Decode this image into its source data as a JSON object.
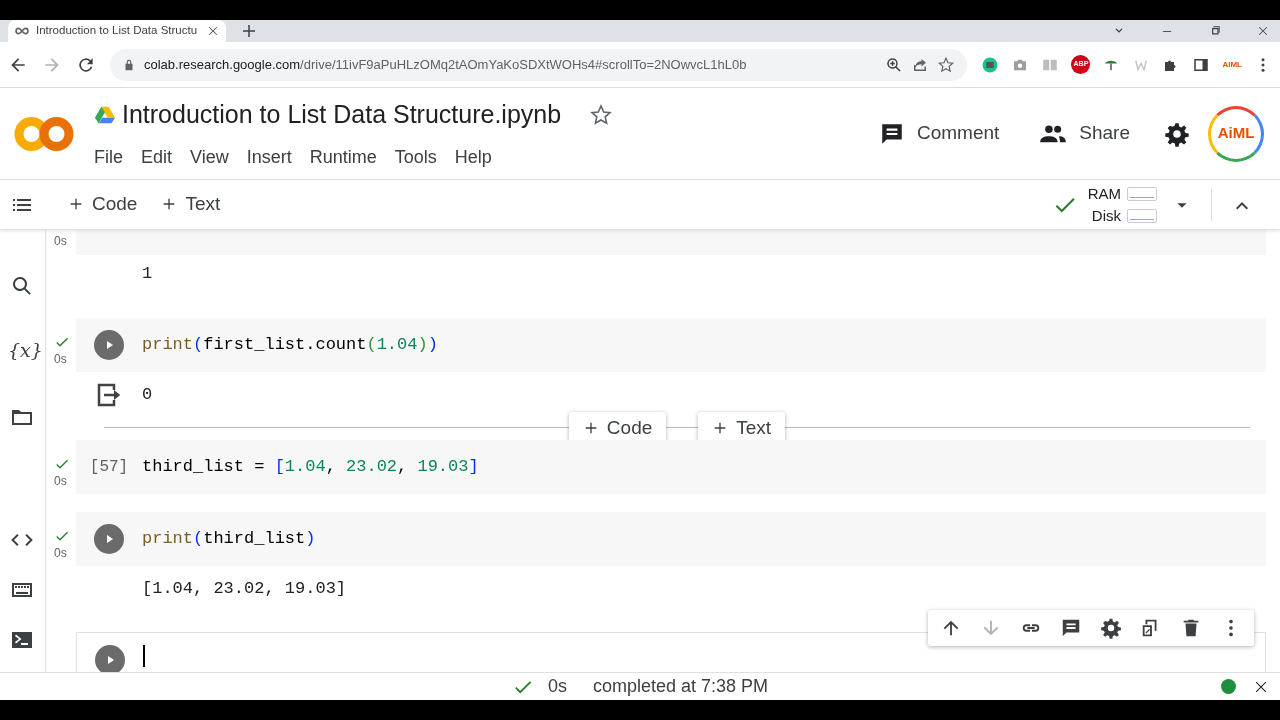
{
  "browser": {
    "tab_title": "Introduction to List Data Structu",
    "url_host": "colab.research.google.com",
    "url_path": "/drive/11ivF9aPuHLzOMq2tAOmYaKoSDXtWOHs4#scrollTo=2NOwvcL1hL0b",
    "extension_labels": [
      "ABP",
      "AIML"
    ]
  },
  "header": {
    "title": "Introduction to List Data Structure.ipynb",
    "starred": false,
    "menu": [
      "File",
      "Edit",
      "View",
      "Insert",
      "Runtime",
      "Tools",
      "Help"
    ],
    "comment": "Comment",
    "share": "Share",
    "avatar_text": "AiML"
  },
  "toolbar": {
    "add_code": "Code",
    "add_text": "Text",
    "ram": "RAM",
    "disk": "Disk",
    "connected": true
  },
  "sidebar": {
    "variables_label": "{x}"
  },
  "cells": [
    {
      "kind": "code",
      "partial": true,
      "exec_time": "0s",
      "output": "1"
    },
    {
      "kind": "code",
      "exec_time": "0s",
      "success": true,
      "code": [
        {
          "kind": "fn",
          "text": "print"
        },
        {
          "kind": "paren",
          "text": "("
        },
        {
          "kind": "name",
          "text": "first_list.count"
        },
        {
          "kind": "paren2",
          "text": "("
        },
        {
          "kind": "num",
          "text": "1.04"
        },
        {
          "kind": "paren2",
          "text": ")"
        },
        {
          "kind": "paren",
          "text": ")"
        }
      ],
      "output": "0",
      "output_icon": true
    },
    {
      "kind": "add_bar",
      "code_label": "Code",
      "text_label": "Text"
    },
    {
      "kind": "code",
      "count": "[57]",
      "exec_time": "0s",
      "success": true,
      "code": [
        {
          "kind": "name",
          "text": "third_list = "
        },
        {
          "kind": "paren",
          "text": "["
        },
        {
          "kind": "num",
          "text": "1.04"
        },
        {
          "kind": "name",
          "text": ", "
        },
        {
          "kind": "num",
          "text": "23.02"
        },
        {
          "kind": "name",
          "text": ", "
        },
        {
          "kind": "num",
          "text": "19.03"
        },
        {
          "kind": "paren",
          "text": "]"
        }
      ]
    },
    {
      "kind": "code",
      "exec_time": "0s",
      "success": true,
      "code": [
        {
          "kind": "fn",
          "text": "print"
        },
        {
          "kind": "paren",
          "text": "("
        },
        {
          "kind": "name",
          "text": "third_list"
        },
        {
          "kind": "paren",
          "text": ")"
        }
      ],
      "output": "[1.04, 23.02, 19.03]"
    },
    {
      "kind": "code",
      "focused": true
    }
  ],
  "status_bar": {
    "success": true,
    "time": "0s",
    "message": "completed at 7:38 PM",
    "connected": true
  }
}
